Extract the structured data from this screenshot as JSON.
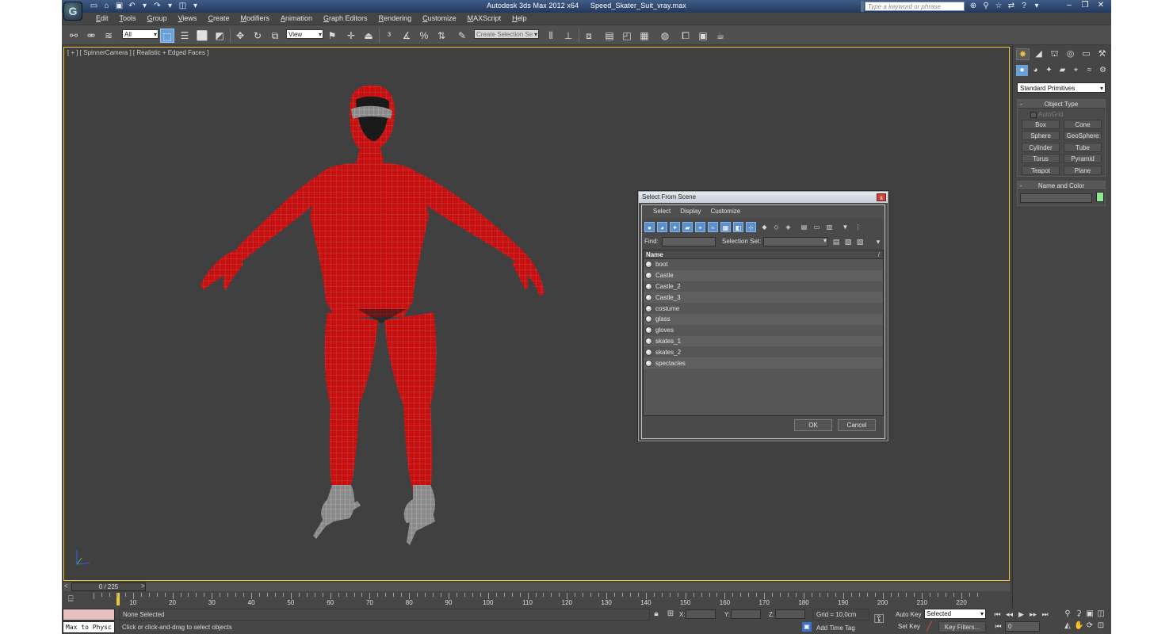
{
  "window": {
    "title": "Autodesk 3ds Max  2012 x64",
    "file": "Speed_Skater_Suit_vray.max",
    "search_placeholder": "Type a keyword or phrase",
    "logo": "G"
  },
  "menu": [
    "Edit",
    "Tools",
    "Group",
    "Views",
    "Create",
    "Modifiers",
    "Animation",
    "Graph Editors",
    "Rendering",
    "Customize",
    "MAXScript",
    "Help"
  ],
  "toolbar": {
    "filter_value": "All",
    "ref_coord_value": "View",
    "selection_set_placeholder": "Create Selection Se"
  },
  "viewport": {
    "label": "[ + ] [ SpinnerCamera ] [ Realistic + Edged Faces ]",
    "body_color": "#cc1010",
    "wire_color": "#b45050"
  },
  "command_panel": {
    "category": "Standard Primitives",
    "object_type_title": "Object Type",
    "autogrid_label": "AutoGrid",
    "buttons": [
      "Box",
      "Cone",
      "Sphere",
      "GeoSphere",
      "Cylinder",
      "Tube",
      "Torus",
      "Pyramid",
      "Teapot",
      "Plane"
    ],
    "name_color_title": "Name and Color",
    "object_color": "#90e896"
  },
  "dialog": {
    "title": "Select From Scene",
    "close_glyph": "x",
    "menu": [
      "Select",
      "Display",
      "Customize"
    ],
    "find_label": "Find:",
    "selection_set_label": "Selection Set:",
    "column_header": "Name",
    "column_sort_glyph": "/",
    "objects": [
      "boot",
      "Castle",
      "Castle_2",
      "Castle_3",
      "costume",
      "glass",
      "gloves",
      "skates_1",
      "skates_2",
      "spectacles"
    ],
    "ok_label": "OK",
    "cancel_label": "Cancel"
  },
  "timeline": {
    "slider_label": "0 / 225",
    "left_arrow": "<",
    "right_arrow": ">",
    "tick_labels": [
      "10",
      "20",
      "30",
      "40",
      "50",
      "60",
      "70",
      "80",
      "90",
      "100",
      "110",
      "120",
      "130",
      "140",
      "150",
      "160",
      "170",
      "180",
      "190",
      "200",
      "210",
      "220"
    ]
  },
  "status": {
    "maxscript_label": "Max to Physc",
    "selection_status": "None Selected",
    "prompt": "Click or click-and-drag to select objects",
    "x_label": "X:",
    "y_label": "Y:",
    "z_label": "Z:",
    "grid_label": "Grid = 10,0cm",
    "add_time_tag": "Add Time Tag",
    "auto_key": "Auto Key",
    "set_key": "Set Key",
    "key_mode_value": "Selected",
    "key_filters": "Key Filters...",
    "frame_value": "0"
  }
}
